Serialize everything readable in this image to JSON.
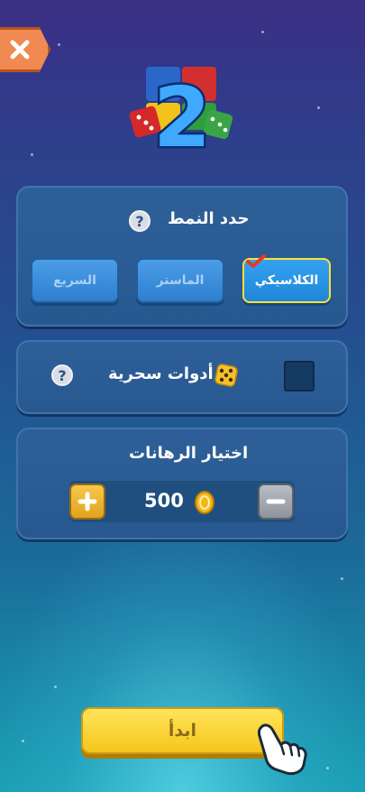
{
  "close_button": {
    "icon": "close-icon",
    "color": "#f08a52"
  },
  "logo": {
    "text": "2",
    "icon": "ludo-2-logo"
  },
  "mode_panel": {
    "title": "حدد النمط",
    "help": "?",
    "modes": [
      {
        "label": "الكلاسيكي",
        "selected": true
      },
      {
        "label": "الماستر",
        "selected": false
      },
      {
        "label": "السريع",
        "selected": false
      }
    ]
  },
  "magic_panel": {
    "title": "أدوات سحرية",
    "help": "?",
    "icon": "dice-icon",
    "enabled": false
  },
  "bet_panel": {
    "title": "اختيار الرهانات",
    "value": "500",
    "plus": "+",
    "minus": "−",
    "coin_icon": "coin-icon"
  },
  "start_button": {
    "label": "ابدأ",
    "icon": "pointing-hand-icon"
  },
  "colors": {
    "accent": "#ffe233",
    "start": "#f6c51d",
    "panel": "#2c5c94"
  }
}
